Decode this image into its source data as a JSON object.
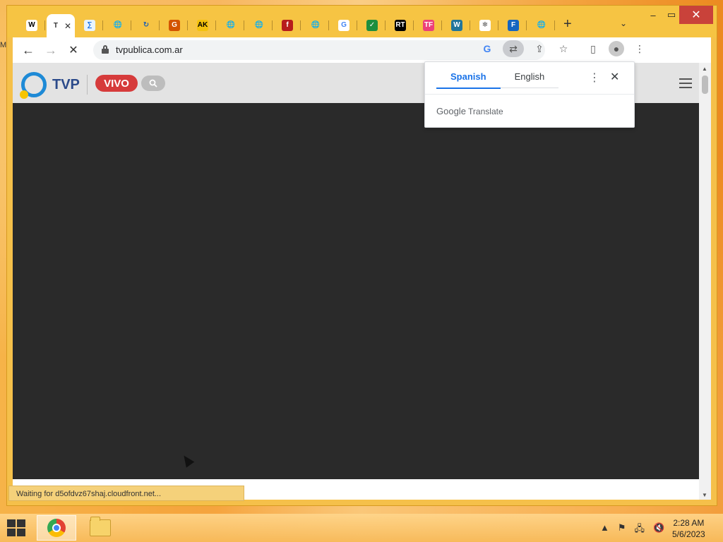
{
  "desktop": {
    "edge_label": "M"
  },
  "browser": {
    "tabs": [
      {
        "icon": "wikipedia-icon",
        "glyph": "W",
        "bg": "#ffffff",
        "fg": "#000000"
      },
      {
        "icon": "active-tab-icon",
        "glyph": "T",
        "active": true,
        "close": "✕",
        "bg": "#ffffff",
        "fg": "#333333"
      },
      {
        "icon": "mathematics-icon",
        "glyph": "∑",
        "bg": "#e8f4ff",
        "fg": "#1a73e8"
      },
      {
        "icon": "globe-icon",
        "glyph": "🌐",
        "bg": "transparent",
        "fg": "#555555"
      },
      {
        "icon": "refresh-site-icon",
        "glyph": "↻",
        "bg": "transparent",
        "fg": "#1a5fb4"
      },
      {
        "icon": "site-g-icon",
        "glyph": "G",
        "bg": "#d35400",
        "fg": "#ffffff"
      },
      {
        "icon": "site-ak-icon",
        "glyph": "AK",
        "bg": "#f4c20d",
        "fg": "#000000"
      },
      {
        "icon": "globe-icon",
        "glyph": "🌐",
        "bg": "transparent",
        "fg": "#555555"
      },
      {
        "icon": "globe-icon",
        "glyph": "🌐",
        "bg": "transparent",
        "fg": "#555555"
      },
      {
        "icon": "site-f-icon",
        "glyph": "f",
        "bg": "#b71c1c",
        "fg": "#ffffff"
      },
      {
        "icon": "globe-icon",
        "glyph": "🌐",
        "bg": "transparent",
        "fg": "#555555"
      },
      {
        "icon": "google-icon",
        "glyph": "G",
        "bg": "#ffffff",
        "fg": "#4285f4"
      },
      {
        "icon": "site-check-icon",
        "glyph": "✓",
        "bg": "#1e8e3e",
        "fg": "#ffffff"
      },
      {
        "icon": "rt-icon",
        "glyph": "RT",
        "bg": "#000000",
        "fg": "#ffffff"
      },
      {
        "icon": "site-tf-icon",
        "glyph": "TF",
        "bg": "#ec407a",
        "fg": "#ffffff"
      },
      {
        "icon": "wordpress-icon",
        "glyph": "W",
        "bg": "#21759b",
        "fg": "#ffffff"
      },
      {
        "icon": "snowflake-icon",
        "glyph": "❄",
        "bg": "#ffffff",
        "fg": "#555555"
      },
      {
        "icon": "site-f2-icon",
        "glyph": "F",
        "bg": "#1565c0",
        "fg": "#ffffff"
      },
      {
        "icon": "globe-icon",
        "glyph": "🌐",
        "bg": "transparent",
        "fg": "#555555"
      }
    ],
    "new_tab": "+",
    "tab_list": "⌄",
    "window_controls": {
      "minimize": "–",
      "maximize": "▭",
      "close": "✕"
    },
    "nav": {
      "back": "←",
      "forward": "→",
      "reload_stop": "✕"
    },
    "address": "tvpublica.com.ar",
    "omnibox_icons": {
      "google": "G",
      "translate": "⇄",
      "share": "⇪",
      "bookmark": "☆"
    },
    "toolbar_icons": {
      "side_panel": "▯",
      "profile": "●",
      "menu": "⋮"
    }
  },
  "site": {
    "logo_text": "TVP",
    "live_label": "VIVO"
  },
  "translate_popup": {
    "tabs": [
      "Spanish",
      "English"
    ],
    "active_tab": "Spanish",
    "menu": "⋮",
    "close": "✕",
    "brand_google": "Google",
    "brand_product": "Translate"
  },
  "status": "Waiting for d5ofdvz67shaj.cloudfront.net...",
  "taskbar": {
    "apps": [
      "chrome",
      "file-explorer"
    ],
    "tray_icons": [
      "▲",
      "⚑",
      "🖧",
      "🔇"
    ],
    "time": "2:28 AM",
    "date": "5/6/2023"
  }
}
